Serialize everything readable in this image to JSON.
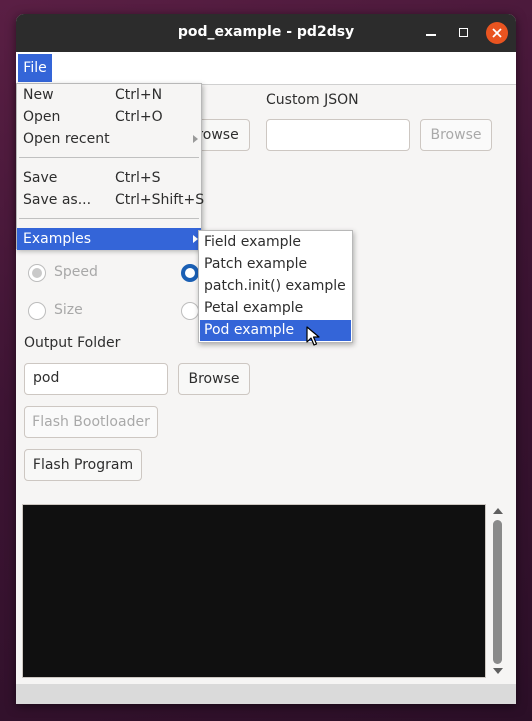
{
  "window": {
    "title": "pod_example - pd2dsy"
  },
  "menubar": {
    "file_label": "File"
  },
  "file_menu": {
    "items": [
      {
        "label": "New",
        "shortcut": "Ctrl+N"
      },
      {
        "label": "Open",
        "shortcut": "Ctrl+O"
      },
      {
        "label": "Open recent",
        "shortcut": ""
      },
      {
        "label": "Save",
        "shortcut": "Ctrl+S"
      },
      {
        "label": "Save as...",
        "shortcut": "Ctrl+Shift+S"
      },
      {
        "label": "Examples",
        "shortcut": ""
      }
    ]
  },
  "examples_menu": {
    "items": [
      {
        "label": "Field example"
      },
      {
        "label": "Patch example"
      },
      {
        "label": "patch.init() example"
      },
      {
        "label": "Petal example"
      },
      {
        "label": "Pod example"
      }
    ],
    "selected": "Pod example"
  },
  "form": {
    "browse_partial": "rowse",
    "custom_json_label": "Custom JSON",
    "custom_json_value": "",
    "custom_json_browse": "Browse",
    "optimize_speed": "Speed",
    "optimize_size": "Size",
    "output_folder_label": "Output Folder",
    "output_folder_value": "pod",
    "output_browse": "Browse",
    "flash_bootloader": "Flash Bootloader",
    "flash_program": "Flash Program"
  },
  "console": {
    "text": ""
  },
  "colors": {
    "accent": "#3465d8",
    "close_button": "#e95420",
    "titlebar": "#2c2c2c",
    "console_bg": "#101010"
  }
}
